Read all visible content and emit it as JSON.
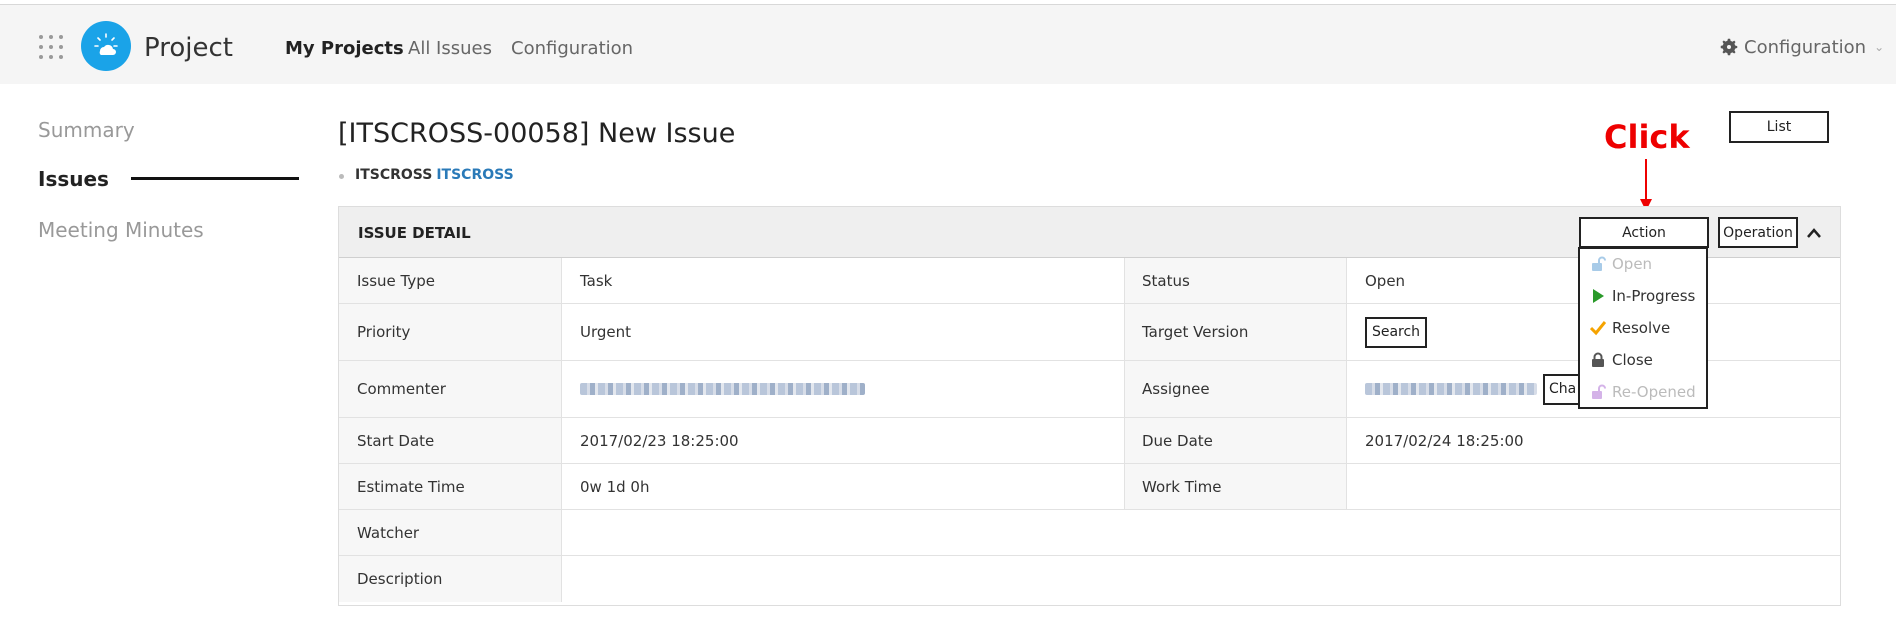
{
  "header": {
    "brand": "Project",
    "nav": [
      "My Projects",
      "All Issues",
      "Configuration"
    ],
    "config_label": "Configuration",
    "logo_color": "#1aa3e8"
  },
  "sidebar": {
    "items": [
      "Summary",
      "Issues",
      "Meeting Minutes"
    ],
    "active": "Issues"
  },
  "issue": {
    "title": "[ITSCROSS-00058] New Issue",
    "crumb_project": "ITSCROSS",
    "crumb_link": "ITSCROSS",
    "list_button": "List"
  },
  "annotation": {
    "text": "Click",
    "color": "#e00000"
  },
  "panel": {
    "title": "ISSUE DETAIL",
    "action_button": "Action",
    "operation_button": "Operation",
    "collapse_icon": "chevron-up-icon"
  },
  "details": {
    "issue_type_label": "Issue Type",
    "issue_type": "Task",
    "status_label": "Status",
    "status": "Open",
    "priority_label": "Priority",
    "priority": "Urgent",
    "target_version_label": "Target Version",
    "search_button": "Search",
    "commenter_label": "Commenter",
    "assignee_label": "Assignee",
    "change_button": "Cha",
    "start_date_label": "Start Date",
    "start_date": "2017/02/23 18:25:00",
    "due_date_label": "Due Date",
    "due_date": "2017/02/24 18:25:00",
    "estimate_label": "Estimate Time",
    "estimate": "0w 1d 0h",
    "work_time_label": "Work Time",
    "work_time": "",
    "watcher_label": "Watcher",
    "watcher": "",
    "description_label": "Description",
    "description": ""
  },
  "action_menu": {
    "items": [
      {
        "label": "Open",
        "icon": "unlock-icon",
        "disabled": true
      },
      {
        "label": "In-Progress",
        "icon": "play-icon",
        "disabled": false
      },
      {
        "label": "Resolve",
        "icon": "checkmark-icon",
        "disabled": false
      },
      {
        "label": "Close",
        "icon": "lock-icon",
        "disabled": false
      },
      {
        "label": "Re-Opened",
        "icon": "unlock-icon",
        "disabled": true
      }
    ]
  }
}
